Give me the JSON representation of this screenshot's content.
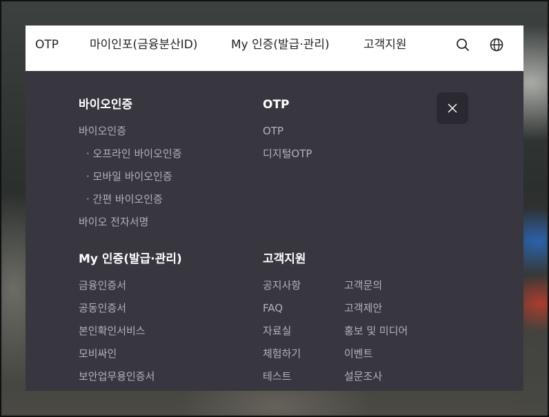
{
  "nav": {
    "items": [
      {
        "label": "OTP"
      },
      {
        "label": "마이인포(금융분산ID)"
      },
      {
        "label": "My 인증(발급·관리)"
      },
      {
        "label": "고객지원"
      }
    ],
    "search_icon": "search-icon",
    "language_icon": "globe-icon"
  },
  "menu": {
    "close_icon": "close-icon",
    "bio": {
      "title": "바이오인증",
      "items": [
        "바이오인증",
        "· 오프라인 바이오인증",
        "· 모바일 바이오인증",
        "· 간편 바이오인증",
        "바이오 전자서명"
      ]
    },
    "otp": {
      "title": "OTP",
      "items": [
        "OTP",
        "디지털OTP"
      ]
    },
    "myauth": {
      "title": "My 인증(발급·관리)",
      "items": [
        "금융인증서",
        "공동인증서",
        "본인확인서비스",
        "모비싸인",
        "보안업무용인증서"
      ]
    },
    "support": {
      "title": "고객지원",
      "left": [
        "공지사항",
        "FAQ",
        "자료실",
        "체험하기",
        "테스트"
      ],
      "right": [
        "고객문의",
        "고객제안",
        "홍보 및 미디어",
        "이벤트",
        "설문조사"
      ]
    }
  }
}
